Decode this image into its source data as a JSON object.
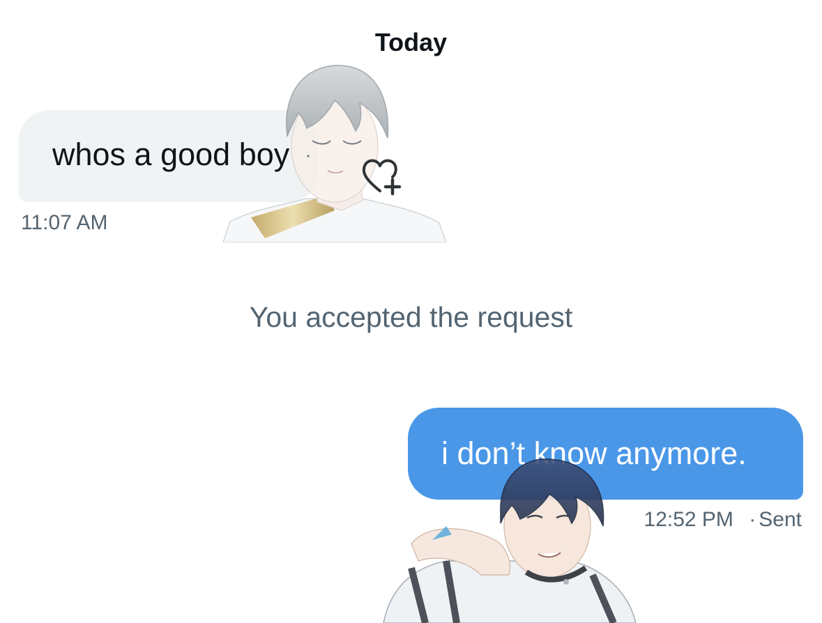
{
  "conversation": {
    "date_header": "Today",
    "messages": [
      {
        "direction": "received",
        "text": "whos a good boy",
        "time": "11:07 AM"
      },
      {
        "direction": "sent",
        "text": "i don’t know anymore.",
        "time": "12:52 PM",
        "status": "Sent",
        "separator": "·"
      }
    ],
    "system_message": "You accepted the request"
  },
  "icons": {
    "reaction": "heart-plus-icon"
  },
  "colors": {
    "received_bubble": "#eff3f4",
    "sent_bubble": "#4a97e8",
    "primary_text": "#0f1419",
    "secondary_text": "#536471"
  }
}
